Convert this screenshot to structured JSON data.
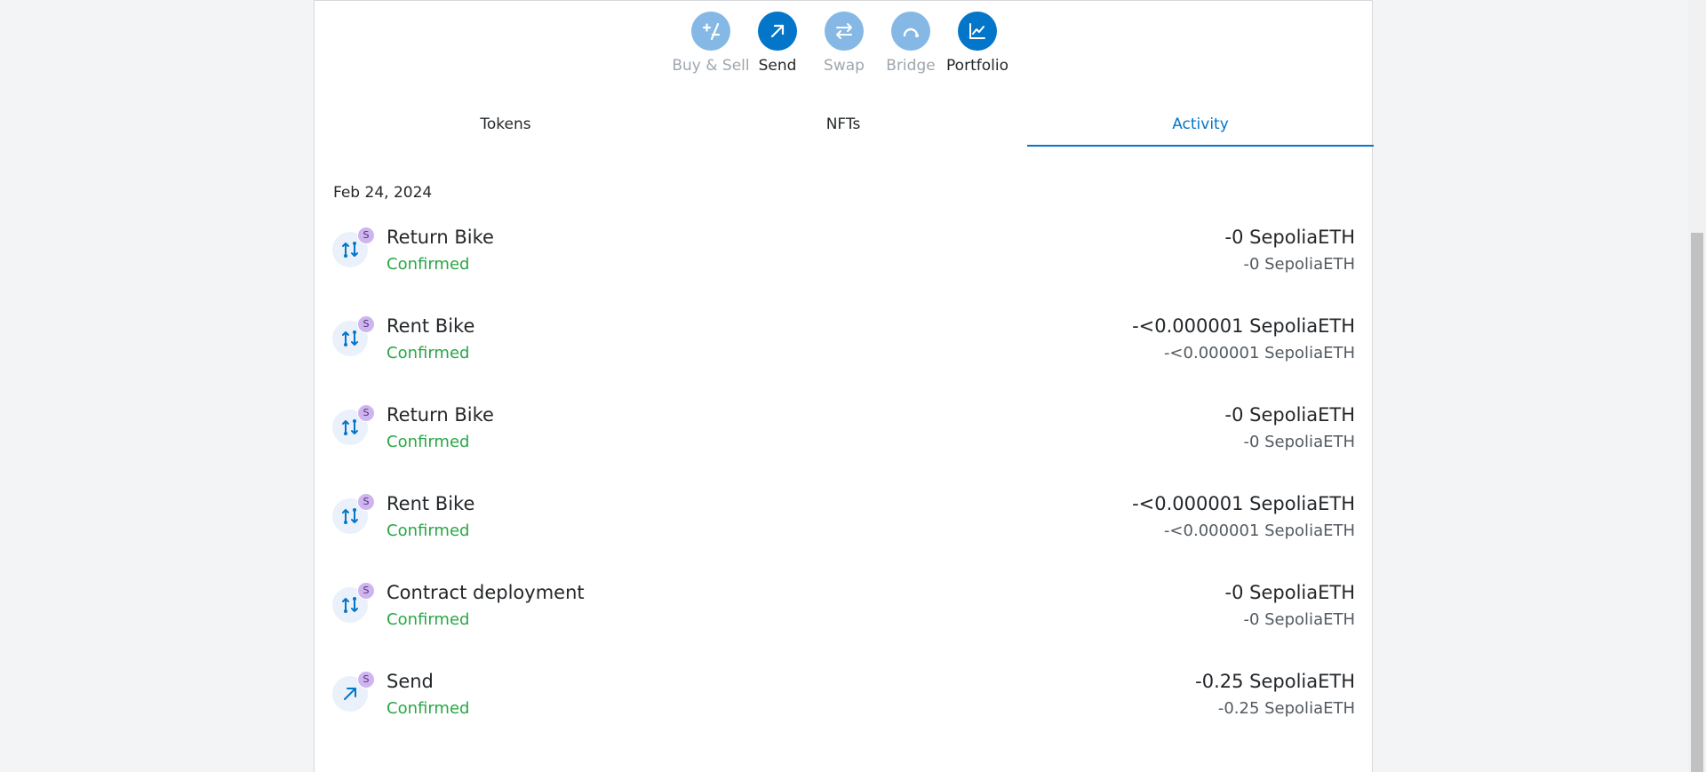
{
  "actions": [
    {
      "label": "Buy & Sell",
      "icon": "plus-minus-icon",
      "enabled": false
    },
    {
      "label": "Send",
      "icon": "arrow-up-right-icon",
      "enabled": true
    },
    {
      "label": "Swap",
      "icon": "swap-arrows-icon",
      "enabled": false
    },
    {
      "label": "Bridge",
      "icon": "bridge-icon",
      "enabled": false
    },
    {
      "label": "Portfolio",
      "icon": "chart-icon",
      "enabled": true
    }
  ],
  "tabs": [
    {
      "label": "Tokens",
      "active": false
    },
    {
      "label": "NFTs",
      "active": false
    },
    {
      "label": "Activity",
      "active": true
    }
  ],
  "activity": {
    "date": "Feb 24, 2024",
    "network_badge": "S",
    "items": [
      {
        "title": "Return Bike",
        "status": "Confirmed",
        "amount": "-0 SepoliaETH",
        "fiat": "-0 SepoliaETH",
        "icon": "contract-interaction-icon"
      },
      {
        "title": "Rent Bike",
        "status": "Confirmed",
        "amount": "-<0.000001 SepoliaETH",
        "fiat": "-<0.000001 SepoliaETH",
        "icon": "contract-interaction-icon"
      },
      {
        "title": "Return Bike",
        "status": "Confirmed",
        "amount": "-0 SepoliaETH",
        "fiat": "-0 SepoliaETH",
        "icon": "contract-interaction-icon"
      },
      {
        "title": "Rent Bike",
        "status": "Confirmed",
        "amount": "-<0.000001 SepoliaETH",
        "fiat": "-<0.000001 SepoliaETH",
        "icon": "contract-interaction-icon"
      },
      {
        "title": "Contract deployment",
        "status": "Confirmed",
        "amount": "-0 SepoliaETH",
        "fiat": "-0 SepoliaETH",
        "icon": "contract-interaction-icon"
      },
      {
        "title": "Send",
        "status": "Confirmed",
        "amount": "-0.25 SepoliaETH",
        "fiat": "-0.25 SepoliaETH",
        "icon": "send-arrow-icon"
      }
    ]
  },
  "colors": {
    "accent": "#0376c9",
    "accent_disabled": "#85b8e4",
    "confirmed": "#28a745",
    "badge": "#cfb5f0"
  }
}
